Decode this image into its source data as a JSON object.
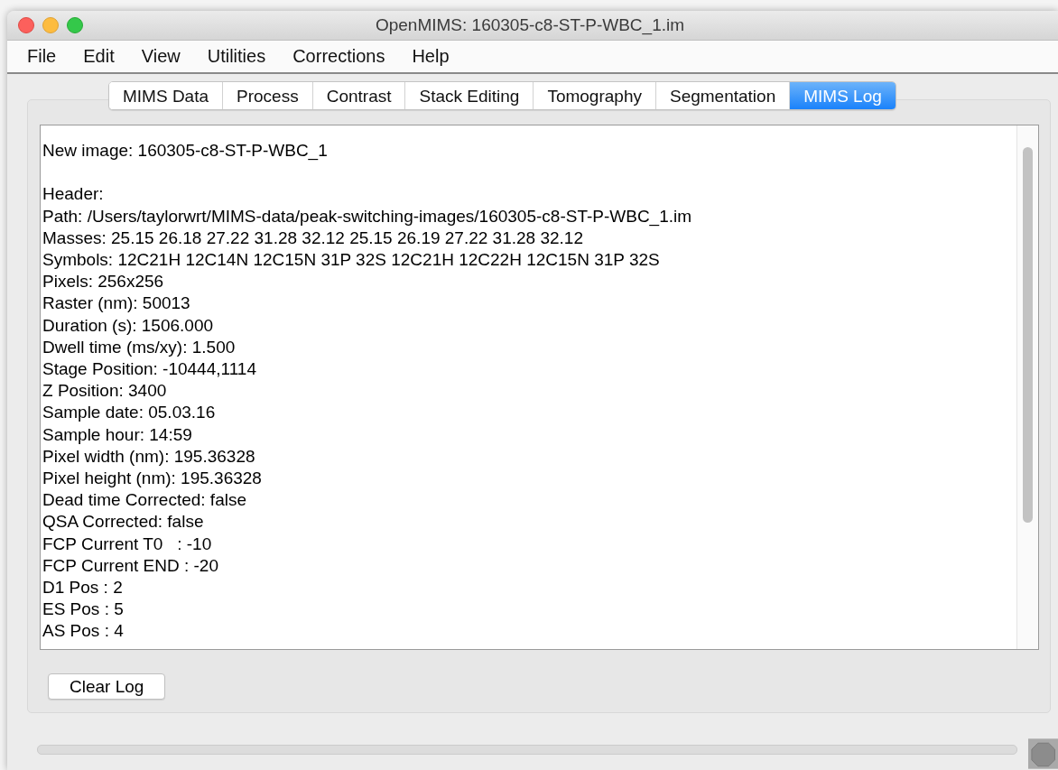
{
  "window": {
    "title": "OpenMIMS: 160305-c8-ST-P-WBC_1.im"
  },
  "menu": [
    "File",
    "Edit",
    "View",
    "Utilities",
    "Corrections",
    "Help"
  ],
  "tabs": [
    {
      "label": "MIMS Data",
      "selected": false
    },
    {
      "label": "Process",
      "selected": false
    },
    {
      "label": "Contrast",
      "selected": false
    },
    {
      "label": "Stack Editing",
      "selected": false
    },
    {
      "label": "Tomography",
      "selected": false
    },
    {
      "label": "Segmentation",
      "selected": false
    },
    {
      "label": "MIMS Log",
      "selected": true
    }
  ],
  "log": {
    "entries": [
      {
        "lines": [
          "New image: 160305-c8-ST-P-WBC_1"
        ]
      },
      {
        "lines": [
          "Header:",
          "Path: /Users/taylorwrt/MIMS-data/peak-switching-images/160305-c8-ST-P-WBC_1.im",
          "Masses: 25.15 26.18 27.22 31.28 32.12 25.15 26.19 27.22 31.28 32.12",
          "Symbols: 12C21H 12C14N 12C15N 31P 32S 12C21H 12C22H 12C15N 31P 32S",
          "Pixels: 256x256",
          "Raster (nm): 50013",
          "Duration (s): 1506.000",
          "Dwell time (ms/xy): 1.500",
          "Stage Position: -10444,1114",
          "Z Position: 3400",
          "Sample date: 05.03.16",
          "Sample hour: 14:59",
          "Pixel width (nm): 195.36328",
          "Pixel height (nm): 195.36328",
          "Dead time Corrected: false",
          "QSA Corrected: false",
          "FCP Current T0   : -10",
          "FCP Current END : -20",
          "D1 Pos : 2",
          "ES Pos : 5",
          "AS Pos : 4"
        ]
      }
    ]
  },
  "buttons": [
    "Clear Log"
  ],
  "progress": {
    "level": 0
  }
}
